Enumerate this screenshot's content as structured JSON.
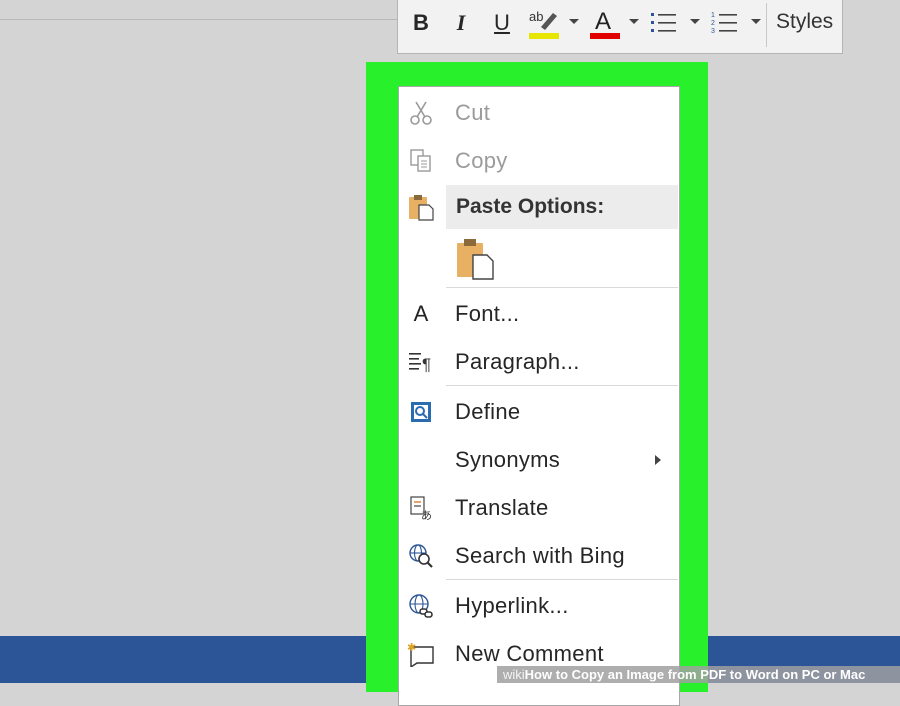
{
  "toolbar": {
    "bold": "B",
    "italic": "I",
    "underline": "U",
    "highlight_glyph": "ab",
    "font_color_glyph": "A",
    "styles": "Styles",
    "highlight_color": "#e6e600",
    "font_color": "#e00000"
  },
  "menu": {
    "cut": "Cut",
    "copy": "Copy",
    "paste_options": "Paste Options:",
    "font": "Font...",
    "paragraph": "Paragraph...",
    "define": "Define",
    "synonyms": "Synonyms",
    "translate": "Translate",
    "search_bing": "Search with Bing",
    "hyperlink": "Hyperlink...",
    "new_comment": "New Comment",
    "font_icon_glyph": "A"
  },
  "colors": {
    "highlight_frame": "#28f02a",
    "status_bar": "#2b5597"
  },
  "credit": {
    "wiki": "wiki",
    "how": "How",
    "title": " to Copy an Image from PDF to Word on PC or Mac"
  }
}
